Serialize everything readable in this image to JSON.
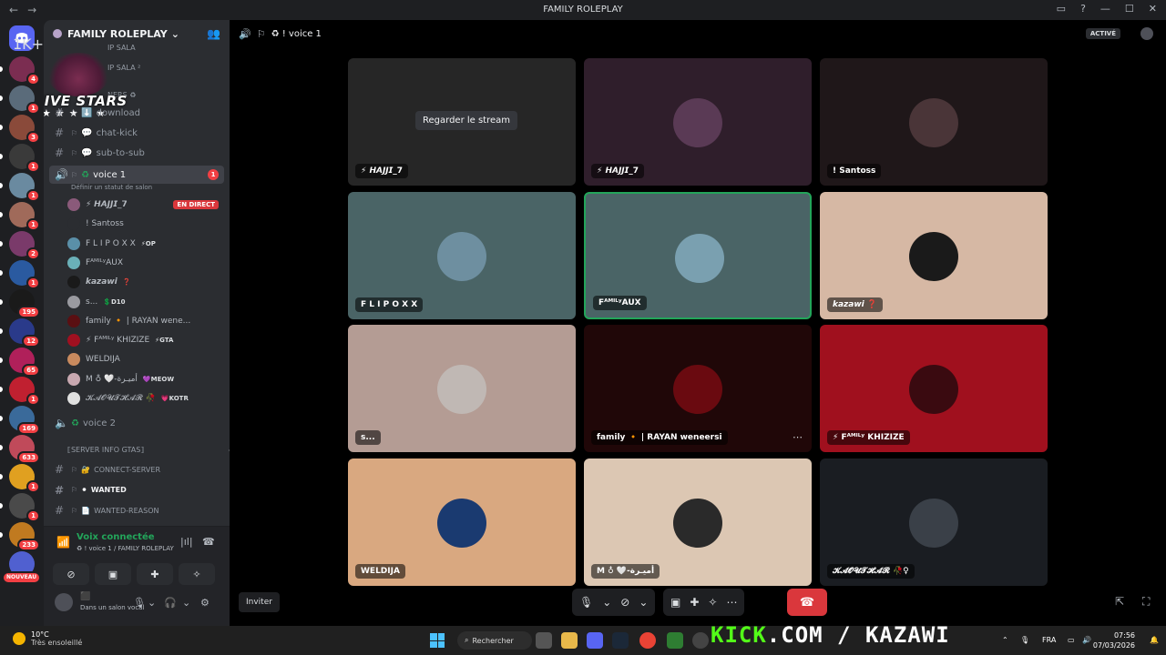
{
  "window": {
    "title": "FAMILY ROLEPLAY",
    "back": "←",
    "forward": "→"
  },
  "server": {
    "name": "FAMILY ROLEPLAY",
    "logo_text": "FIVE STARS",
    "logo_stars": "★★★★★",
    "partial_items": [
      "IP SALA",
      "IP SALA ²",
      "NERS ♻"
    ]
  },
  "rail_badges": [
    "1K+",
    "4",
    "1",
    "3",
    "1",
    "1",
    "1",
    "2",
    "1",
    "195",
    "12",
    "65",
    "1",
    "169",
    "633",
    "1",
    "1",
    "233",
    "NOUVEAU"
  ],
  "channels": [
    {
      "name": "download",
      "prefix": "⬇️"
    },
    {
      "name": "chat-kick",
      "prefix": "💬"
    },
    {
      "name": "sub-to-sub",
      "prefix": "💬"
    }
  ],
  "voice1": {
    "name": "voice 1",
    "prefix": "♻",
    "badge": "1",
    "status_hint": "Définir un statut de salon"
  },
  "voice_users": [
    {
      "name": "⚡ 𝙃𝘼𝙅𝙅𝙄_𝟳",
      "tag": "",
      "live": "EN DIRECT",
      "color": "#8a5a7a"
    },
    {
      "name": "! Santoss",
      "tag": "",
      "live": "",
      "color": "#2b2d31"
    },
    {
      "name": "F L I P O X X",
      "tag": "⚡OP",
      "live": "",
      "color": "#5a8fa8"
    },
    {
      "name": "FᴬᴹᴵᴸʸAUX",
      "tag": "",
      "live": "",
      "color": "#6ab0b8"
    },
    {
      "name": "𝙠𝙖𝙯𝙖𝙬𝙞",
      "tag": "❓",
      "live": "",
      "color": "#1a1a1a"
    },
    {
      "name": "s...",
      "tag": "💲D10",
      "live": "",
      "color": "#9a9aa0"
    },
    {
      "name": "family 🔸 | RAYAN wene...",
      "tag": "",
      "live": "",
      "color": "#5a0f12"
    },
    {
      "name": "⚡ Fᴬᴹᴵᴸʸ KHIZIZE",
      "tag": "⚡GTA",
      "live": "",
      "color": "#a01020"
    },
    {
      "name": "WELDIJA",
      "tag": "",
      "live": "",
      "color": "#c98a5e"
    },
    {
      "name": "M ♁ 🤍-أميـرة",
      "tag": "💜MEOW",
      "live": "",
      "color": "#c8a8b0"
    },
    {
      "name": "𝓚𝓐𝓞𝓤𝓣𝓗𝓐𝓡 🥀",
      "tag": "💗KOTR",
      "live": "",
      "color": "#e0e0e0"
    }
  ],
  "voice2": {
    "name": "voice 2",
    "prefix": "♻"
  },
  "server_info_category": "⟦SERVER INFO GTAS⟧",
  "info_channels": [
    {
      "name": "CONNECT-SERVER",
      "prefix": "🔐",
      "bold": false
    },
    {
      "name": "WANTED",
      "prefix": "⚫",
      "bold": true
    },
    {
      "name": "WANTED-REASON",
      "prefix": "📄",
      "bold": false
    }
  ],
  "voice_panel": {
    "status": "Voix connectée",
    "location": "♻ ! voice 1 / FAMILY ROLEPLAY"
  },
  "user_panel": {
    "status": "Dans un salon vocal"
  },
  "stage": {
    "channel": "♻ ! voice 1",
    "activity_badge": "ACTIVÉ",
    "watch_stream": "Regarder le stream",
    "invite": "Inviter"
  },
  "tiles": [
    {
      "label": "⚡ 𝙃𝘼𝙅𝙅𝙄_𝟳",
      "bg": "#262626",
      "avatar": "",
      "stream": true,
      "active": false,
      "more": false
    },
    {
      "label": "⚡ 𝙃𝘼𝙅𝙅𝙄_𝟳",
      "bg": "#2f1e2b",
      "avatar": "#5a3a55",
      "stream": false,
      "active": false,
      "more": false
    },
    {
      "label": "! Santoss",
      "bg": "#1f1719",
      "avatar": "#4a3538",
      "stream": false,
      "active": false,
      "more": false
    },
    {
      "label": "F L I P O X X",
      "bg": "#4a6466",
      "avatar": "#6e8fa0",
      "stream": false,
      "active": false,
      "more": false
    },
    {
      "label": "FᴬᴹᴵᴸʸAUX",
      "bg": "#4a6466",
      "avatar": "#7aa0b0",
      "stream": false,
      "active": true,
      "more": false
    },
    {
      "label": "𝙠𝙖𝙯𝙖𝙬𝙞 ❓",
      "bg": "#d6b8a4",
      "avatar": "#1a1a1a",
      "stream": false,
      "active": false,
      "more": false
    },
    {
      "label": "s...",
      "bg": "#b49c94",
      "avatar": "#c0b8b4",
      "stream": false,
      "active": false,
      "more": false
    },
    {
      "label": "family 🔸 | RAYAN weneersi",
      "bg": "#200708",
      "avatar": "#6a0a10",
      "stream": false,
      "active": false,
      "more": true
    },
    {
      "label": "⚡ Fᴬᴹᴵᴸʸ KHIZIZE",
      "bg": "#a0101e",
      "avatar": "#3a0a10",
      "stream": false,
      "active": false,
      "more": false
    },
    {
      "label": "WELDIJA",
      "bg": "#d9a880",
      "avatar": "#1a3a70",
      "stream": false,
      "active": false,
      "more": false
    },
    {
      "label": "M ♁ 🤍-أميـرة",
      "bg": "#dcc7b3",
      "avatar": "#2a2a2a",
      "stream": false,
      "active": false,
      "more": false
    },
    {
      "label": "𝓚𝓐𝓞𝓤𝓣𝓗𝓐𝓡 🥀♀",
      "bg": "#1a1d22",
      "avatar": "#3a4048",
      "stream": false,
      "active": false,
      "more": false
    }
  ],
  "taskbar": {
    "temp": "10°C",
    "weather": "Très ensoleillé",
    "search": "Rechercher",
    "overlay_pre": "KICK",
    "overlay_post": ".COM / KAZAWI",
    "lang": "FRA",
    "time": "07:56",
    "date": "07/03/2026"
  },
  "colors": {
    "accent_green": "#23a55a",
    "danger": "#da373c",
    "badge": "#f23f43",
    "kick_green": "#53fc18"
  },
  "icons": [
    "discord-icon",
    "hash-icon",
    "speaker-icon",
    "mic-icon",
    "headphones-icon",
    "gear-icon",
    "hangup-icon",
    "camera-off-icon",
    "screen-share-icon",
    "activities-icon",
    "soundboard-icon",
    "popout-icon",
    "fullscreen-icon"
  ]
}
